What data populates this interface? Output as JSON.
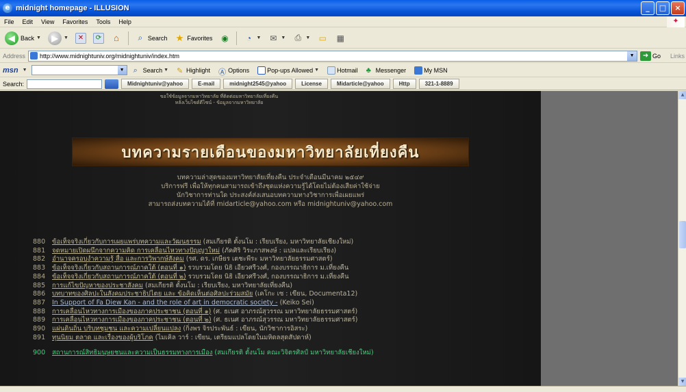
{
  "window": {
    "title": "midnight homepage - ILLUSION"
  },
  "menu": [
    "File",
    "Edit",
    "View",
    "Favorites",
    "Tools",
    "Help"
  ],
  "toolbar": {
    "back": "Back",
    "search": "Search",
    "favorites": "Favorites"
  },
  "address": {
    "label": "Address",
    "url": "http://www.midnightuniv.org/midnightuniv/index.htm",
    "go": "Go",
    "links": "Links"
  },
  "msn": {
    "logo": "msn",
    "search": "Search",
    "highlight": "Highlight",
    "options": "Options",
    "popups": "Pop-ups Allowed",
    "hotmail": "Hotmail",
    "messenger": "Messenger",
    "mymsn": "My MSN"
  },
  "linksbar": {
    "search_label": "Search:",
    "buttons": [
      "Midnightuniv@yahoo",
      "E-mail",
      "midnight2545@yahoo",
      "License",
      "Midarticle@yahoo",
      "Http",
      "321-1-8889"
    ]
  },
  "page": {
    "top_note_1": "ขอใช้ข้อมูลจากมหาวิทยาลัย ที่ติดต่อมหาวิทยาลัยเที่ยงคืน",
    "top_note_2": "หลังเว็บไซต์ดีไซน์ - ข้อมูลจากมหาวิทยาลัย",
    "banner": "บทความรายเดือนของมหาวิทยาลัยเที่ยงคืน",
    "intro": [
      "บทความล่าสุดของมหาวิทยาลัยเที่ยงคืน ประจำเดือนมีนาคม ๒๕๔๙",
      "บริการฟรี เพื่อให้ทุกคนสามารถเข้าถึงชุดแห่งความรู้ได้โดยไม่ต้องเสียค่าใช้จ่าย",
      "นักวิชาการท่านใด ประสงค์ส่งเสนอบทความทางวิชาการเพื่อเผยแพร่",
      "สามารถส่งบทความได้ที่ midarticle@yahoo.com หรือ midnightuniv@yahoo.com"
    ]
  },
  "articles": [
    {
      "num": "880",
      "title": "ข้อเท็จจริงเกี่ยวกับการเผยแพร่บทความและวัฒนธรรม",
      "author": "(สมเกียรติ ตั้งนโม : เรียบเรียง, มหาวิทยาลัยเชียงใหม่)",
      "style": ""
    },
    {
      "num": "881",
      "title": "จดหมายเปิดผนึกจากความคิด การเคลื่อนไหวทางปัญญาใหม่",
      "author": "(ภัคศิริ วิระภาสพงษ์ : แปลและเรียบเรียง)",
      "style": ""
    },
    {
      "num": "882",
      "title": "อำนาจครอบงำความรู้ สื่อ และการวิพากษ์สังคม",
      "author": "(รศ. ดร. เกษียร เตชะพีระ มหาวิทยาลัยธรรมศาสตร์)",
      "style": ""
    },
    {
      "num": "883",
      "title": "ข้อเท็จจริงเกี่ยวกับสถานการณ์ภาคใต้ (ตอนที่ ๑)",
      "author": "รวบรวมโดย นิธิ เอียวศรีวงศ์, กองบรรณาธิการ ม.เที่ยงคืน",
      "style": ""
    },
    {
      "num": "884",
      "title": "ข้อเท็จจริงเกี่ยวกับสถานการณ์ภาคใต้ (ตอนที่ ๒)",
      "author": "รวบรวมโดย นิธิ เอียวศรีวงศ์, กองบรรณาธิการ ม.เที่ยงคืน",
      "style": ""
    },
    {
      "num": "885",
      "title": "การแก้ไขปัญหาของประชาสังคม",
      "author": "(สมเกียรติ ตั้งนโม : เรียบเรียง, มหาวิทยาลัยเที่ยงคืน)",
      "style": ""
    },
    {
      "num": "886",
      "title": "บทบาทของศิลปะในสังคมประชาธิปไตย และ ข้อคิดเห็นต่อศิลปะร่วมสมัย",
      "author": "(เคโกะ เซ : เขียน, Documenta12)",
      "style": ""
    },
    {
      "num": "887",
      "title": "In Support of Fa Diew Kan - and the role of art in democratic society -",
      "author": "(Keiko Sei)",
      "style": "blue"
    },
    {
      "num": "888",
      "title": "การเคลื่อนไหวทางการเมืองของภาคประชาชน (ตอนที่ ๑)",
      "author": "(ศ. ธเนศ อาภรณ์สุวรรณ มหาวิทยาลัยธรรมศาสตร์)",
      "style": ""
    },
    {
      "num": "889",
      "title": "การเคลื่อนไหวทางการเมืองของภาคประชาชน (ตอนที่ ๒)",
      "author": "(ศ. ธเนศ อาภรณ์สุวรรณ มหาวิทยาลัยธรรมศาสตร์)",
      "style": ""
    },
    {
      "num": "890",
      "title": "แผ่นดินถิ่น บริบทชุมชน และความเปลี่ยนแปลง",
      "author": "(กิ่งพร จิรประพันธ์ : เขียน, นักวิชาการอิสระ)",
      "style": ""
    },
    {
      "num": "891",
      "title": "ทุนนิยม ตลาด และเรื่องของผู้บริโภค",
      "author": "(ไมเคิล วาร์ : เขียน, เตรียมแปลโดยในมหิดลสุดสัปดาห์)",
      "style": ""
    },
    {
      "num": "900",
      "title": "สถานการณ์สิทธิมนุษยชนและความเป็นธรรมทางการเมือง",
      "author": "(สมเกียรติ ตั้งนโม คณะวิจิตรศิลป์ มหาวิทยาลัยเชียงใหม่)",
      "style": "hi gap"
    }
  ]
}
